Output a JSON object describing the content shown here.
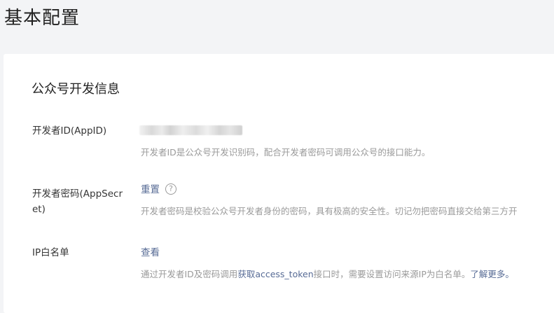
{
  "page": {
    "title": "基本配置"
  },
  "card": {
    "section_title": "公众号开发信息",
    "appid": {
      "label": "开发者ID(AppID)",
      "description": "开发者ID是公众号开发识别码，配合开发者密码可调用公众号的接口能力。"
    },
    "secret": {
      "label": "开发者密码(AppSecret)",
      "reset_label": "重置",
      "help_icon": "question-circle-icon",
      "description": "开发者密码是校验公众号开发者身份的密码，具有极高的安全性。切记勿把密码直接交给第三方开"
    },
    "ip_whitelist": {
      "label": "IP白名单",
      "view_label": "查看",
      "desc_prefix": "通过开发者ID及密码调用",
      "desc_link": "获取access_token",
      "desc_middle": "接口时，需要设置访问来源IP为白名单。",
      "desc_more": "了解更多。"
    }
  },
  "colors": {
    "link": "#576b95",
    "muted": "#9a9a9a",
    "background": "#f3f4f6"
  }
}
